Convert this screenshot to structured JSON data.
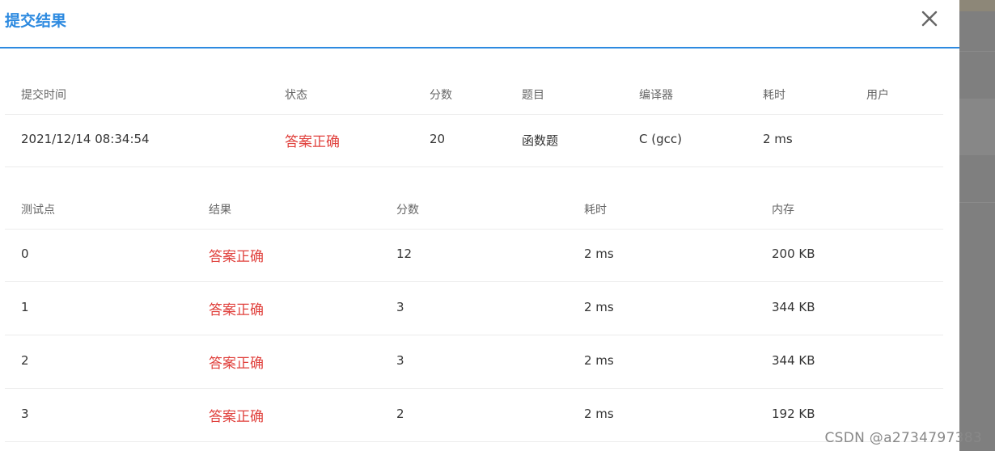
{
  "dialog": {
    "title": "提交结果",
    "accent_color": "#2d8ae0",
    "close_icon": "close-icon"
  },
  "submission": {
    "headers": {
      "time": "提交时间",
      "status": "状态",
      "score": "分数",
      "problem": "题目",
      "compiler": "编译器",
      "duration": "耗时",
      "user": "用户"
    },
    "row": {
      "time": "2021/12/14 08:34:54",
      "status": "答案正确",
      "score": "20",
      "problem": "函数题",
      "compiler": "C (gcc)",
      "duration": "2 ms",
      "user": ""
    }
  },
  "testcases": {
    "headers": {
      "point": "测试点",
      "result": "结果",
      "score": "分数",
      "duration": "耗时",
      "memory": "内存"
    },
    "rows": [
      {
        "point": "0",
        "result": "答案正确",
        "score": "12",
        "duration": "2 ms",
        "memory": "200 KB"
      },
      {
        "point": "1",
        "result": "答案正确",
        "score": "3",
        "duration": "2 ms",
        "memory": "344 KB"
      },
      {
        "point": "2",
        "result": "答案正确",
        "score": "3",
        "duration": "2 ms",
        "memory": "344 KB"
      },
      {
        "point": "3",
        "result": "答案正确",
        "score": "2",
        "duration": "2 ms",
        "memory": "192 KB"
      }
    ]
  },
  "status_color": "#e0403c",
  "watermark": "CSDN @a2734797383"
}
